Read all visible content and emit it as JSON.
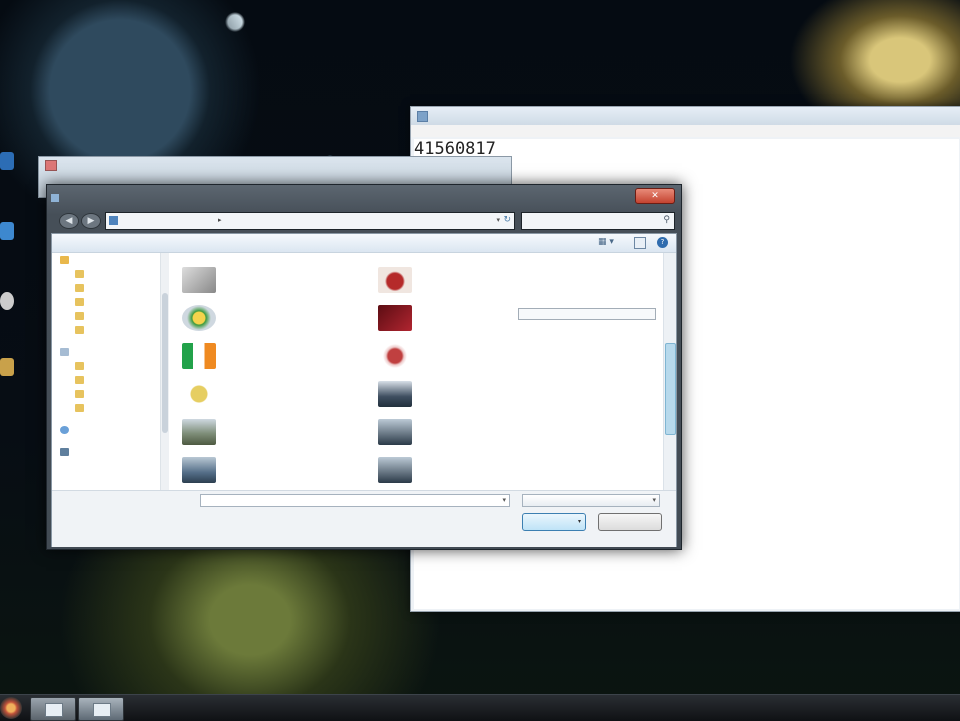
{
  "notepad": {
    "title": "",
    "menu": [],
    "content": "41560817"
  },
  "paint": {
    "title": "",
    "menu": []
  },
  "dialog": {
    "title": "",
    "close_glyph": "✕",
    "back_glyph": "◀",
    "forward_glyph": "▶",
    "address_text": "",
    "address_arrow": "▸",
    "address_dropdown": "▾",
    "refresh_glyph": "↻",
    "search_placeholder": "",
    "search_icon": "⚲",
    "toolbar": {
      "organize": "",
      "new_folder": "",
      "view_glyph": "▦ ▾",
      "help_glyph": "?"
    },
    "nav": {
      "favorites": "",
      "favorites_items": [
        "",
        "",
        "",
        "",
        ""
      ],
      "libraries": "",
      "libraries_items": [
        "",
        "",
        "",
        ""
      ],
      "homegroup": "",
      "computer": ""
    },
    "files": [],
    "tooltip": "",
    "filename_label": "",
    "filename_value": "",
    "filetype_value": "",
    "open_label": "",
    "cancel_label": "",
    "dropdown_glyph": "▾"
  },
  "colors": {
    "dialog_close": "#c44330",
    "open_button": "#bfe3f7"
  }
}
